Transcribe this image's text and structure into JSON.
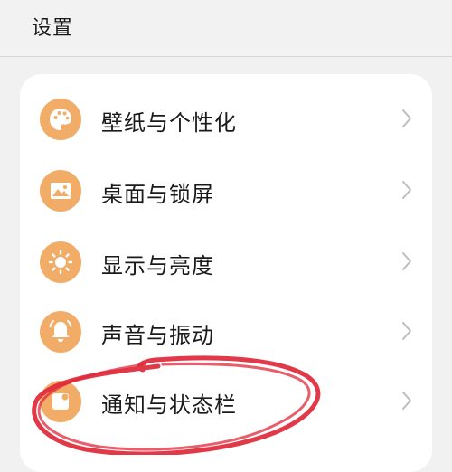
{
  "header": {
    "title": "设置"
  },
  "settings": {
    "items": [
      {
        "label": "壁纸与个性化",
        "icon": "palette-icon"
      },
      {
        "label": "桌面与锁屏",
        "icon": "image-icon"
      },
      {
        "label": "显示与亮度",
        "icon": "sun-icon"
      },
      {
        "label": "声音与振动",
        "icon": "bell-icon"
      },
      {
        "label": "通知与状态栏",
        "icon": "notification-icon"
      }
    ]
  },
  "colors": {
    "icon_background": "#f1ac67",
    "annotation_stroke": "#e0283a",
    "page_background": "#f1f1f1",
    "card_background": "#ffffff"
  }
}
